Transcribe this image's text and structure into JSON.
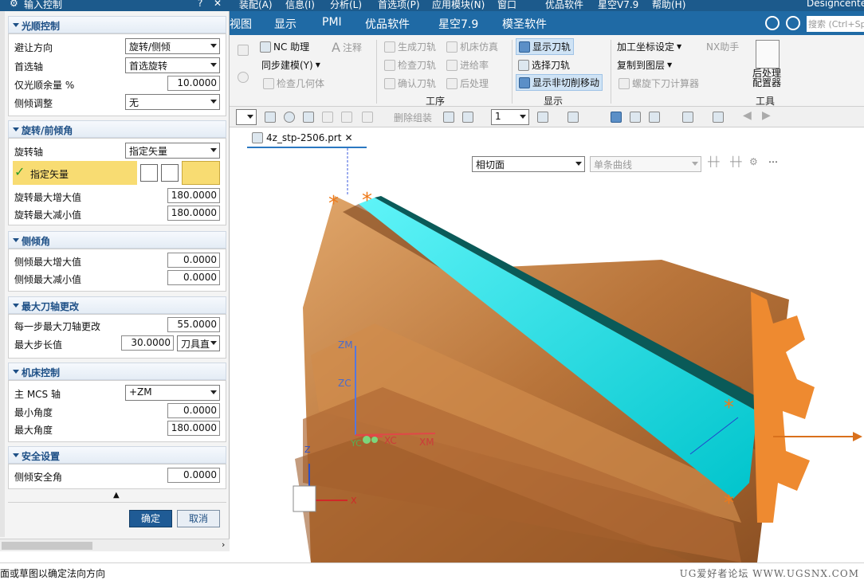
{
  "menubar": {
    "items": [
      "装配(A)",
      "信息(I)",
      "分析(L)",
      "首选项(P)",
      "应用模块(N)",
      "窗口",
      "优品软件",
      "星空V7.9",
      "帮助(H)"
    ],
    "right_text": "Designcenter"
  },
  "tabs": [
    "视图",
    "显示",
    "PMI",
    "优品软件",
    "星空7.9",
    "模圣软件"
  ],
  "search": {
    "placeholder": "搜索 (Ctrl+Sp"
  },
  "ribbon": {
    "nc_helper": "NC 助理",
    "annotation": "注释",
    "sync_modeling": "同步建模(Y)",
    "inspect_geometry": "检查几何体",
    "gen_toolpath": "生成刀轨",
    "machine_sim": "机床仿真",
    "check_toolpath": "检查刀轨",
    "feed_rate": "进给率",
    "confirm_toolpath": "确认刀轨",
    "postprocess": "后处理",
    "group_process": "工序",
    "show_toolpath": "显示刀轨",
    "select_toolpath": "选择刀轨",
    "show_noncut": "显示非切削移动",
    "group_display": "显示",
    "machine_csys": "加工坐标设定",
    "copy_layer": "复制到图层",
    "nx_helper": "NX助手",
    "spiral_calc": "螺旋下刀计算器",
    "post_config_line1": "后处理",
    "post_config_line2": "配置器",
    "group_tools": "工具"
  },
  "toolbar2": {
    "delete_group": "删除组装",
    "layer_value": "1"
  },
  "graphics_tab": {
    "title": "4z_stp-2506.prt"
  },
  "graphics_toolbar": {
    "filter_value": "相切面",
    "curve_rule": "单条曲线"
  },
  "dialog": {
    "title": "输入控制",
    "sections": {
      "smooth": {
        "header": "光顺控制",
        "avoid_dir_label": "避让方向",
        "avoid_dir_value": "旋转/侧倾",
        "pref_axis_label": "首选轴",
        "pref_axis_value": "首选旋转",
        "smooth_rest_label": "仅光顺余量 %",
        "smooth_rest_value": "10.0000",
        "side_tilt_label": "侧倾调整",
        "side_tilt_value": "无"
      },
      "rotate": {
        "header": "旋转/前倾角",
        "axis_label": "旋转轴",
        "axis_value": "指定矢量",
        "vector_label": "指定矢量",
        "max_inc_label": "旋转最大增大值",
        "max_inc_value": "180.0000",
        "max_dec_label": "旋转最大减小值",
        "max_dec_value": "180.0000"
      },
      "tilt": {
        "header": "侧倾角",
        "max_inc_label": "侧倾最大增大值",
        "max_inc_value": "0.0000",
        "max_dec_label": "侧倾最大减小值",
        "max_dec_value": "0.0000"
      },
      "axis_change": {
        "header": "最大刀轴更改",
        "per_step_label": "每一步最大刀轴更改",
        "per_step_value": "55.0000",
        "max_step_label": "最大步长值",
        "max_step_value": "30.0000",
        "max_step_unit": "刀具直"
      },
      "machine": {
        "header": "机床控制",
        "mcs_label": "主 MCS 轴",
        "mcs_value": "+ZM",
        "min_angle_label": "最小角度",
        "min_angle_value": "0.0000",
        "max_angle_label": "最大角度",
        "max_angle_value": "180.0000"
      },
      "safety": {
        "header": "安全设置",
        "side_safe_label": "侧倾安全角",
        "side_safe_value": "0.0000"
      }
    },
    "ok": "确定",
    "cancel": "取消"
  },
  "axes": {
    "zm": "ZM",
    "zc": "ZC",
    "xc": "XC",
    "xm": "XM",
    "yc": "YC",
    "z": "Z",
    "x": "X"
  },
  "status": {
    "message": "面或草图以确定法向方向",
    "watermark": "UG爱好者论坛 WWW.UGSNX.COM"
  },
  "colors": {
    "accent": "#1f6aa5",
    "toolpath": "#00e5ee",
    "part": "#c98545",
    "fixture": "#ee8a30"
  }
}
